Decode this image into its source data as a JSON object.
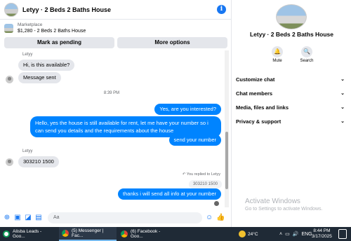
{
  "header": {
    "title": "Letyy · 2 Beds 2 Baths House",
    "info_icon": "info-icon"
  },
  "listing": {
    "source": "Marketplace",
    "price_title": "$1,280 - 2 Beds 2 Baths House"
  },
  "actions": {
    "mark_pending": "Mark as pending",
    "more_options": "More options"
  },
  "chat": {
    "sender1": "Letyy",
    "msg1": "Hi, is this available?",
    "msg2": "Message sent",
    "time": "8:39 PM",
    "out1": "Yes, are you interested?",
    "out2": "Hello, yes the house is still available for rent, let me have your number so i can send you details and the requirements about the house",
    "out3": "send your number",
    "sender2": "Letyy",
    "msg3": "303210 1500",
    "reply_note": "You replied to Letyy",
    "quoted": "303210 1500",
    "out4": "thanks i will send all info at your number"
  },
  "composer": {
    "placeholder": "Aa"
  },
  "right": {
    "name": "Letyy · 2 Beds 2 Baths House",
    "mute": "Mute",
    "search": "Search",
    "menu": [
      "Customize chat",
      "Chat members",
      "Media, files and links",
      "Privacy & support"
    ]
  },
  "watermark": {
    "line1": "Activate Windows",
    "line2": "Go to Settings to activate Windows."
  },
  "taskbar": {
    "tasks": [
      "Alisba Leads - Goo...",
      "(5) Messenger | Fac...",
      "(6) Facebook - Goo..."
    ],
    "temp": "24°C",
    "lang": "ENG",
    "time": "8:44 PM",
    "date": "3/17/2025"
  }
}
